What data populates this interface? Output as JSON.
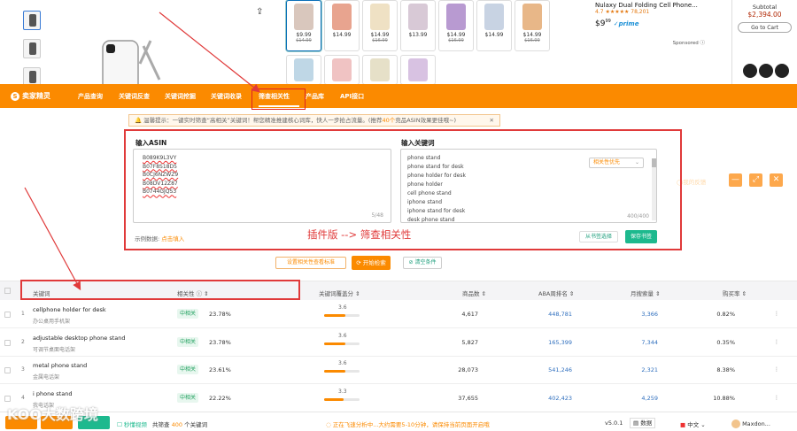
{
  "amazon": {
    "variants": [
      {
        "price": "$9.99",
        "old": "$14.99",
        "color": "#d9c7bd"
      },
      {
        "price": "$14.99",
        "old": "",
        "color": "#e8a48f"
      },
      {
        "price": "$14.99",
        "old": "$16.99",
        "color": "#efe1c4"
      },
      {
        "price": "$13.99",
        "old": "",
        "color": "#d8c9d6"
      },
      {
        "price": "$14.99",
        "old": "$16.99",
        "color": "#b89ad1"
      },
      {
        "price": "$14.99",
        "old": "",
        "color": "#c8d3e3"
      },
      {
        "price": "$14.99",
        "old": "$16.99",
        "color": "#e8b788"
      }
    ],
    "variants_row2_colors": [
      "#bfd7e6",
      "#f0c3c3",
      "#e6e0c8",
      "#d8c2e2"
    ],
    "sponsored": {
      "title": "Nulaxy Dual Folding Cell Phone...",
      "stars": "4.7 ★★★★★ 78,201",
      "price": "$9",
      "price_cents": "99",
      "prime": "✓prime",
      "label": "Sponsored ⓘ"
    },
    "cart": {
      "subtotal_label": "Subtotal",
      "subtotal": "$2,394.00",
      "button": "Go to Cart"
    }
  },
  "header": {
    "logo": "卖家精灵",
    "nav": [
      "产品查询",
      "关键词反查",
      "关键词挖掘",
      "关键词收录",
      "筛查相关性",
      "产品库",
      "API接口"
    ],
    "active": "筛查相关性",
    "collapse": "︾",
    "feedback": "◯我的反馈",
    "win": [
      "—",
      "⤢",
      "✕"
    ]
  },
  "tip": {
    "text1": "温馨提示：一键实时筛查“高相关”关键词！帮您精准推建核心词库，快人一步抢占流量。(推荐",
    "highlight": "40个",
    "text2": "竞品ASIN效果更佳哦~)",
    "close": "✕"
  },
  "panel": {
    "asin_label": "输入ASIN",
    "asins": [
      "B089K9L3VY",
      "B07F8S18D5",
      "B0CJ6NZWZ9",
      "B08DV12Z87",
      "B0744GJQS3"
    ],
    "asin_count": "5/48",
    "kw_label": "输入关键词",
    "keywords": [
      "phone stand",
      "phone stand for desk",
      "phone holder for desk",
      "phone holder",
      "cell phone stand",
      "iphone stand",
      "iphone stand for desk",
      "desk phone stand"
    ],
    "kw_select": "相关性优先",
    "kw_count": "400/400",
    "sample_label": "示例数据:",
    "sample_link": "点击填入",
    "annotation": "插件版 --> 筛查相关性",
    "from_kw": "从书签选择",
    "save_kw": "保存书签"
  },
  "actions": {
    "relevance_std": "设置相关性查看标准",
    "start": "⟳ 开始检索",
    "clear": "⊘ 清空条件"
  },
  "table": {
    "headers": {
      "keyword": "关键词",
      "relevance": "相关性 ⓘ ⇕",
      "score": "关键词覆盖分 ⇕",
      "products": "商品数 ⇕",
      "aba": "ABA周排名 ⇕",
      "searches": "月搜索量 ⇕",
      "buy": "购买率 ⇕"
    },
    "rows": [
      {
        "idx": "1",
        "en": "cellphone holder for desk",
        "cn": "办公桌用手机架",
        "tag": "中相关",
        "pct": "23.78%",
        "score": "3.6",
        "fill": 0.6,
        "products": "4,617",
        "aba": "448,781",
        "searches": "3,366",
        "buy": "0.82%"
      },
      {
        "idx": "2",
        "en": "adjustable desktop phone stand",
        "cn": "可调节桌面电话架",
        "tag": "中相关",
        "pct": "23.78%",
        "score": "3.6",
        "fill": 0.6,
        "products": "5,827",
        "aba": "165,399",
        "searches": "7,344",
        "buy": "0.35%"
      },
      {
        "idx": "3",
        "en": "metal phone stand",
        "cn": "金属电话架",
        "tag": "中相关",
        "pct": "23.61%",
        "score": "3.6",
        "fill": 0.6,
        "products": "28,073",
        "aba": "541,246",
        "searches": "2,321",
        "buy": "8.38%"
      },
      {
        "idx": "4",
        "en": "i phone stand",
        "cn": "我电话架",
        "tag": "中相关",
        "pct": "22.22%",
        "score": "3.3",
        "fill": 0.55,
        "products": "37,655",
        "aba": "402,423",
        "searches": "4,259",
        "buy": "10.88%"
      }
    ]
  },
  "footer": {
    "watermark": "KOO大数跨境",
    "count_label": "共筛查",
    "count": "400",
    "count_unit": "个关键词",
    "status": "◌ 正在飞速分析中...大约需要5-10分钟，请保持当前页面开启哦",
    "version": "v5.0.1",
    "data": "▤ 数据",
    "lang": "中文",
    "user": "Maxdon..."
  },
  "colors": {
    "brand": "#fb8a00",
    "red": "#e03a3a",
    "green": "#1db98e"
  }
}
